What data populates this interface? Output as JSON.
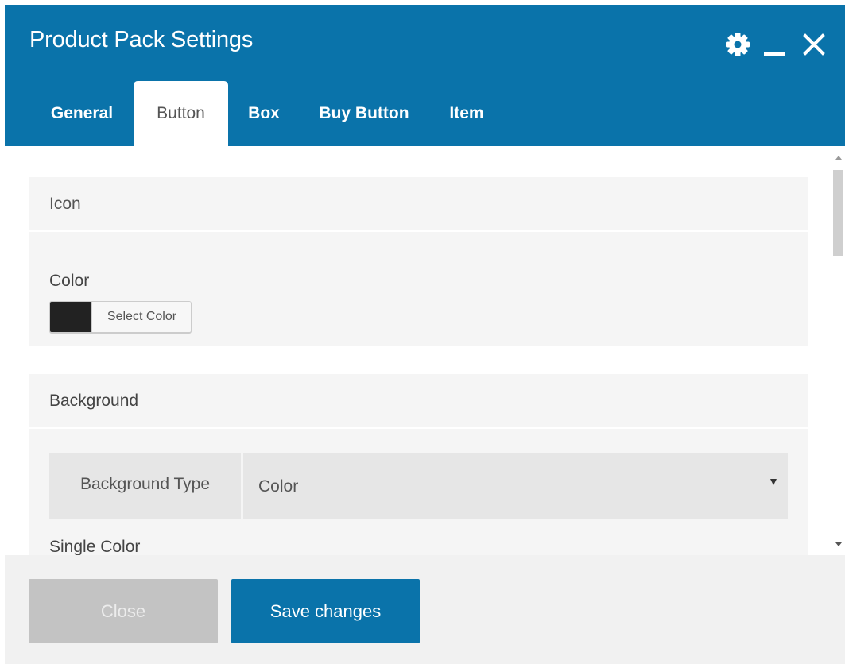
{
  "window": {
    "title": "Product Pack Settings",
    "icons": {
      "settings": "gear-icon",
      "minimize": "minimize-icon",
      "close": "close-icon"
    }
  },
  "tabs": [
    {
      "label": "General",
      "active": false
    },
    {
      "label": "Button",
      "active": true
    },
    {
      "label": "Box",
      "active": false
    },
    {
      "label": "Buy Button",
      "active": false
    },
    {
      "label": "Item",
      "active": false
    }
  ],
  "icon_section": {
    "heading": "Icon",
    "color_label": "Color",
    "color_button": "Select Color",
    "color_value": "#222222"
  },
  "background_section": {
    "heading": "Background",
    "type_label": "Background Type",
    "type_value": "Color",
    "single_color_label": "Single Color"
  },
  "footer": {
    "close_label": "Close",
    "save_label": "Save changes"
  },
  "colors": {
    "accent": "#0a73aa",
    "close_button": "#c3c3c3"
  }
}
